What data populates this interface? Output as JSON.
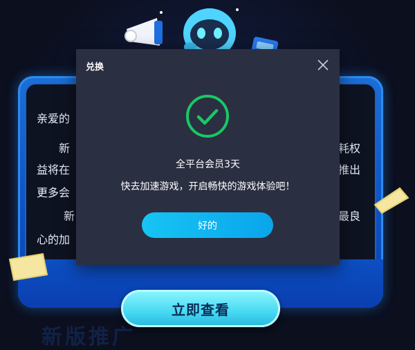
{
  "promo": {
    "greeting": "亲爱的",
    "para1_left": "新",
    "para1_right": "耗权",
    "para2_left": "益将在",
    "para2_right": "推出",
    "para3_left": "更多会",
    "para4_left": "新",
    "para4_right": "最良",
    "para5_left": "心的加",
    "view_button": "立即查看",
    "footer_partial": "新版推广"
  },
  "modal": {
    "title": "兑换",
    "message_line1": "全平台会员3天",
    "message_line2": "快去加速游戏，开启畅快的游戏体验吧！",
    "ok_button": "好的"
  },
  "colors": {
    "modal_bg": "#2b2f42",
    "accent": "#10b5f0",
    "check_green": "#19c864",
    "promo_blue": "#1b6fd6"
  },
  "icons": {
    "close": "close-icon",
    "check": "check-circle-icon",
    "mascot": "mascot-with-megaphone"
  }
}
